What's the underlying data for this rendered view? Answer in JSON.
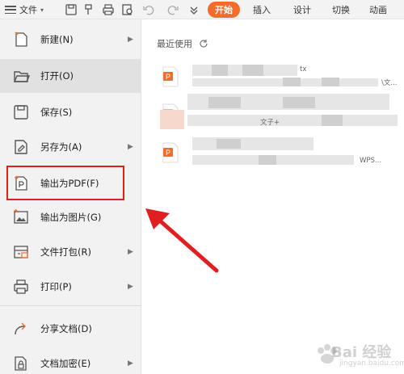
{
  "toolbar": {
    "file_label": "文件",
    "tabs": [
      {
        "label": "开始",
        "active": true
      },
      {
        "label": "插入",
        "active": false
      },
      {
        "label": "设计",
        "active": false
      },
      {
        "label": "切换",
        "active": false
      },
      {
        "label": "动画",
        "active": false
      }
    ],
    "icons": [
      "save-icon",
      "format-painter-icon",
      "print-icon",
      "print-preview-icon",
      "undo-icon",
      "redo-icon",
      "customize-icon"
    ]
  },
  "menu": {
    "items": [
      {
        "label": "新建(N)",
        "icon": "new-icon",
        "arrow": true
      },
      {
        "label": "打开(O)",
        "icon": "folder-icon",
        "arrow": false,
        "selected": true
      },
      {
        "label": "保存(S)",
        "icon": "save-icon",
        "arrow": false
      },
      {
        "label": "另存为(A)",
        "icon": "save-as-icon",
        "arrow": true
      },
      {
        "label": "输出为PDF(F)",
        "icon": "pdf-icon",
        "arrow": false,
        "highlighted": true
      },
      {
        "label": "输出为图片(G)",
        "icon": "image-icon",
        "arrow": false
      },
      {
        "label": "文件打包(R)",
        "icon": "package-icon",
        "arrow": true
      },
      {
        "label": "打印(P)",
        "icon": "print-icon",
        "arrow": true
      },
      {
        "label": "分享文档(D)",
        "icon": "share-icon",
        "arrow": false
      },
      {
        "label": "文档加密(E)",
        "icon": "lock-icon",
        "arrow": true
      }
    ]
  },
  "recent": {
    "title": "最近使用",
    "files": [
      {
        "name_fragment": "tx",
        "path_fragment": "\\文..."
      },
      {
        "name_fragment": "",
        "path_fragment": "文子+"
      },
      {
        "name_fragment": "",
        "path_fragment": "WPS..."
      }
    ]
  },
  "watermark": {
    "text": "Bai 经验",
    "sub": "jingyan.baidu.com"
  },
  "colors": {
    "accent": "#f36c2c",
    "highlight": "#e02020",
    "arrow": "#e02020"
  }
}
